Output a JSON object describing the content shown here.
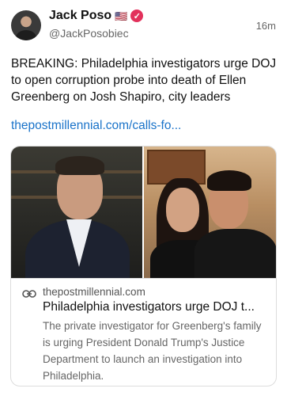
{
  "author": {
    "name": "Jack Poso",
    "flag": "🇺🇸",
    "handle": "@JackPosobiec",
    "time": "16m"
  },
  "post": {
    "text": "BREAKING: Philadelphia investigators urge DOJ to open corruption probe into death of Ellen Greenberg on Josh Shapiro, city leaders",
    "link": "thepostmillennial.com/calls-fo..."
  },
  "card": {
    "domain": "thepostmillennial.com",
    "title": "Philadelphia investigators urge DOJ t...",
    "description": "The private investigator for Greenberg's family is urging President Donald Trump's Justice Department to launch an investigation into Philadelphia."
  },
  "colors": {
    "link": "#1a73c9",
    "verified_badge": "#e2315b"
  },
  "icons": {
    "verified": "verified-badge-icon",
    "link": "link-icon"
  }
}
